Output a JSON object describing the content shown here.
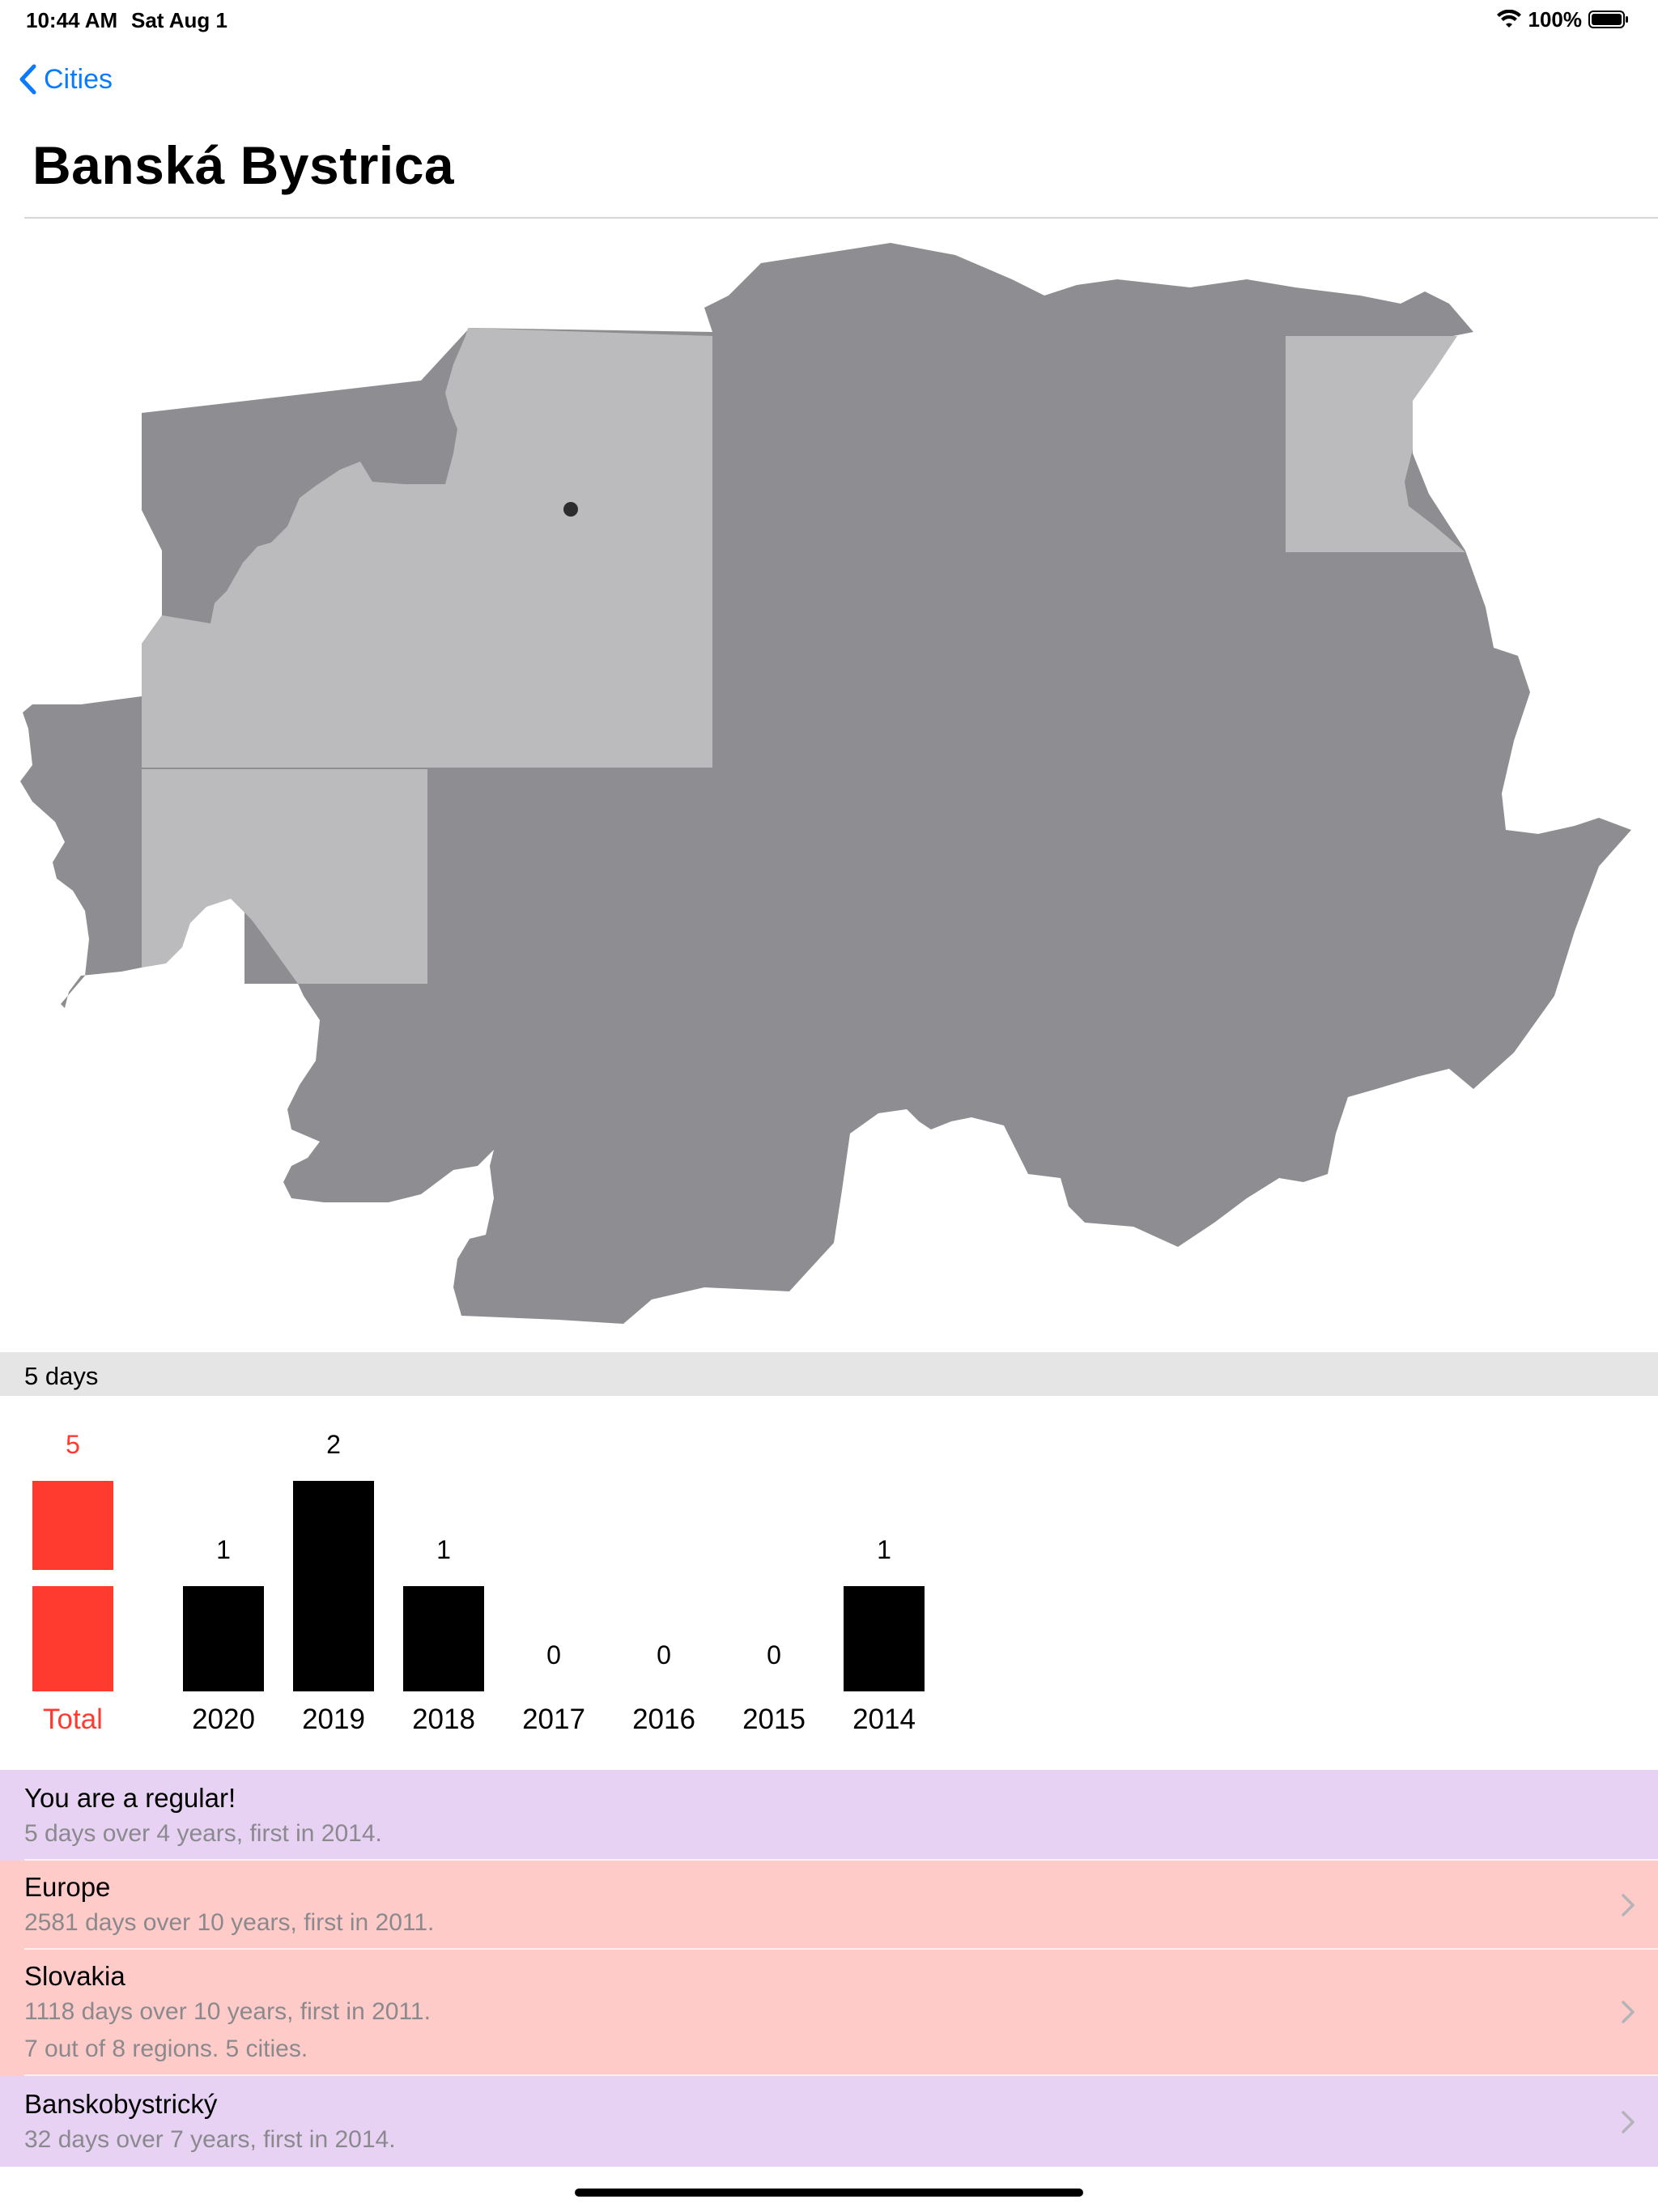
{
  "status_bar": {
    "time": "10:44 AM",
    "date": "Sat Aug 1",
    "battery": "100%"
  },
  "nav": {
    "back_label": "Cities"
  },
  "page": {
    "title": "Banská Bystrica"
  },
  "colors": {
    "accent": "#0a7aff",
    "region_dark": "#8e8e92",
    "region_light": "#bbbbbd",
    "total_red": "#ff3b30",
    "regular_row": "#e8d2f4",
    "country_row": "#ffcbc8",
    "section_header": "#e5e5e5"
  },
  "summary": {
    "days_label": "5 days"
  },
  "chart_data": {
    "type": "bar",
    "total": {
      "label": "Total",
      "value": 5
    },
    "categories": [
      "2020",
      "2019",
      "2018",
      "2017",
      "2016",
      "2015",
      "2014"
    ],
    "values": [
      1,
      2,
      1,
      0,
      0,
      0,
      1
    ]
  },
  "rows": [
    {
      "title": "You are a regular!",
      "lines": [
        "5 days over 4 years, first in 2014."
      ],
      "chevron": false,
      "color": "#e8d2f4"
    },
    {
      "title": "Europe",
      "lines": [
        "2581 days over 10 years, first in 2011."
      ],
      "chevron": true,
      "color": "#ffcbc8"
    },
    {
      "title": "Slovakia",
      "lines": [
        "1118 days over 10 years, first in 2011.",
        "7 out of 8 regions. 5 cities."
      ],
      "chevron": true,
      "color": "#ffcbc8"
    },
    {
      "title": "Banskobystrický",
      "lines": [
        "32 days over 7 years, first in 2014."
      ],
      "chevron": true,
      "color": "#e8d2f4"
    }
  ]
}
